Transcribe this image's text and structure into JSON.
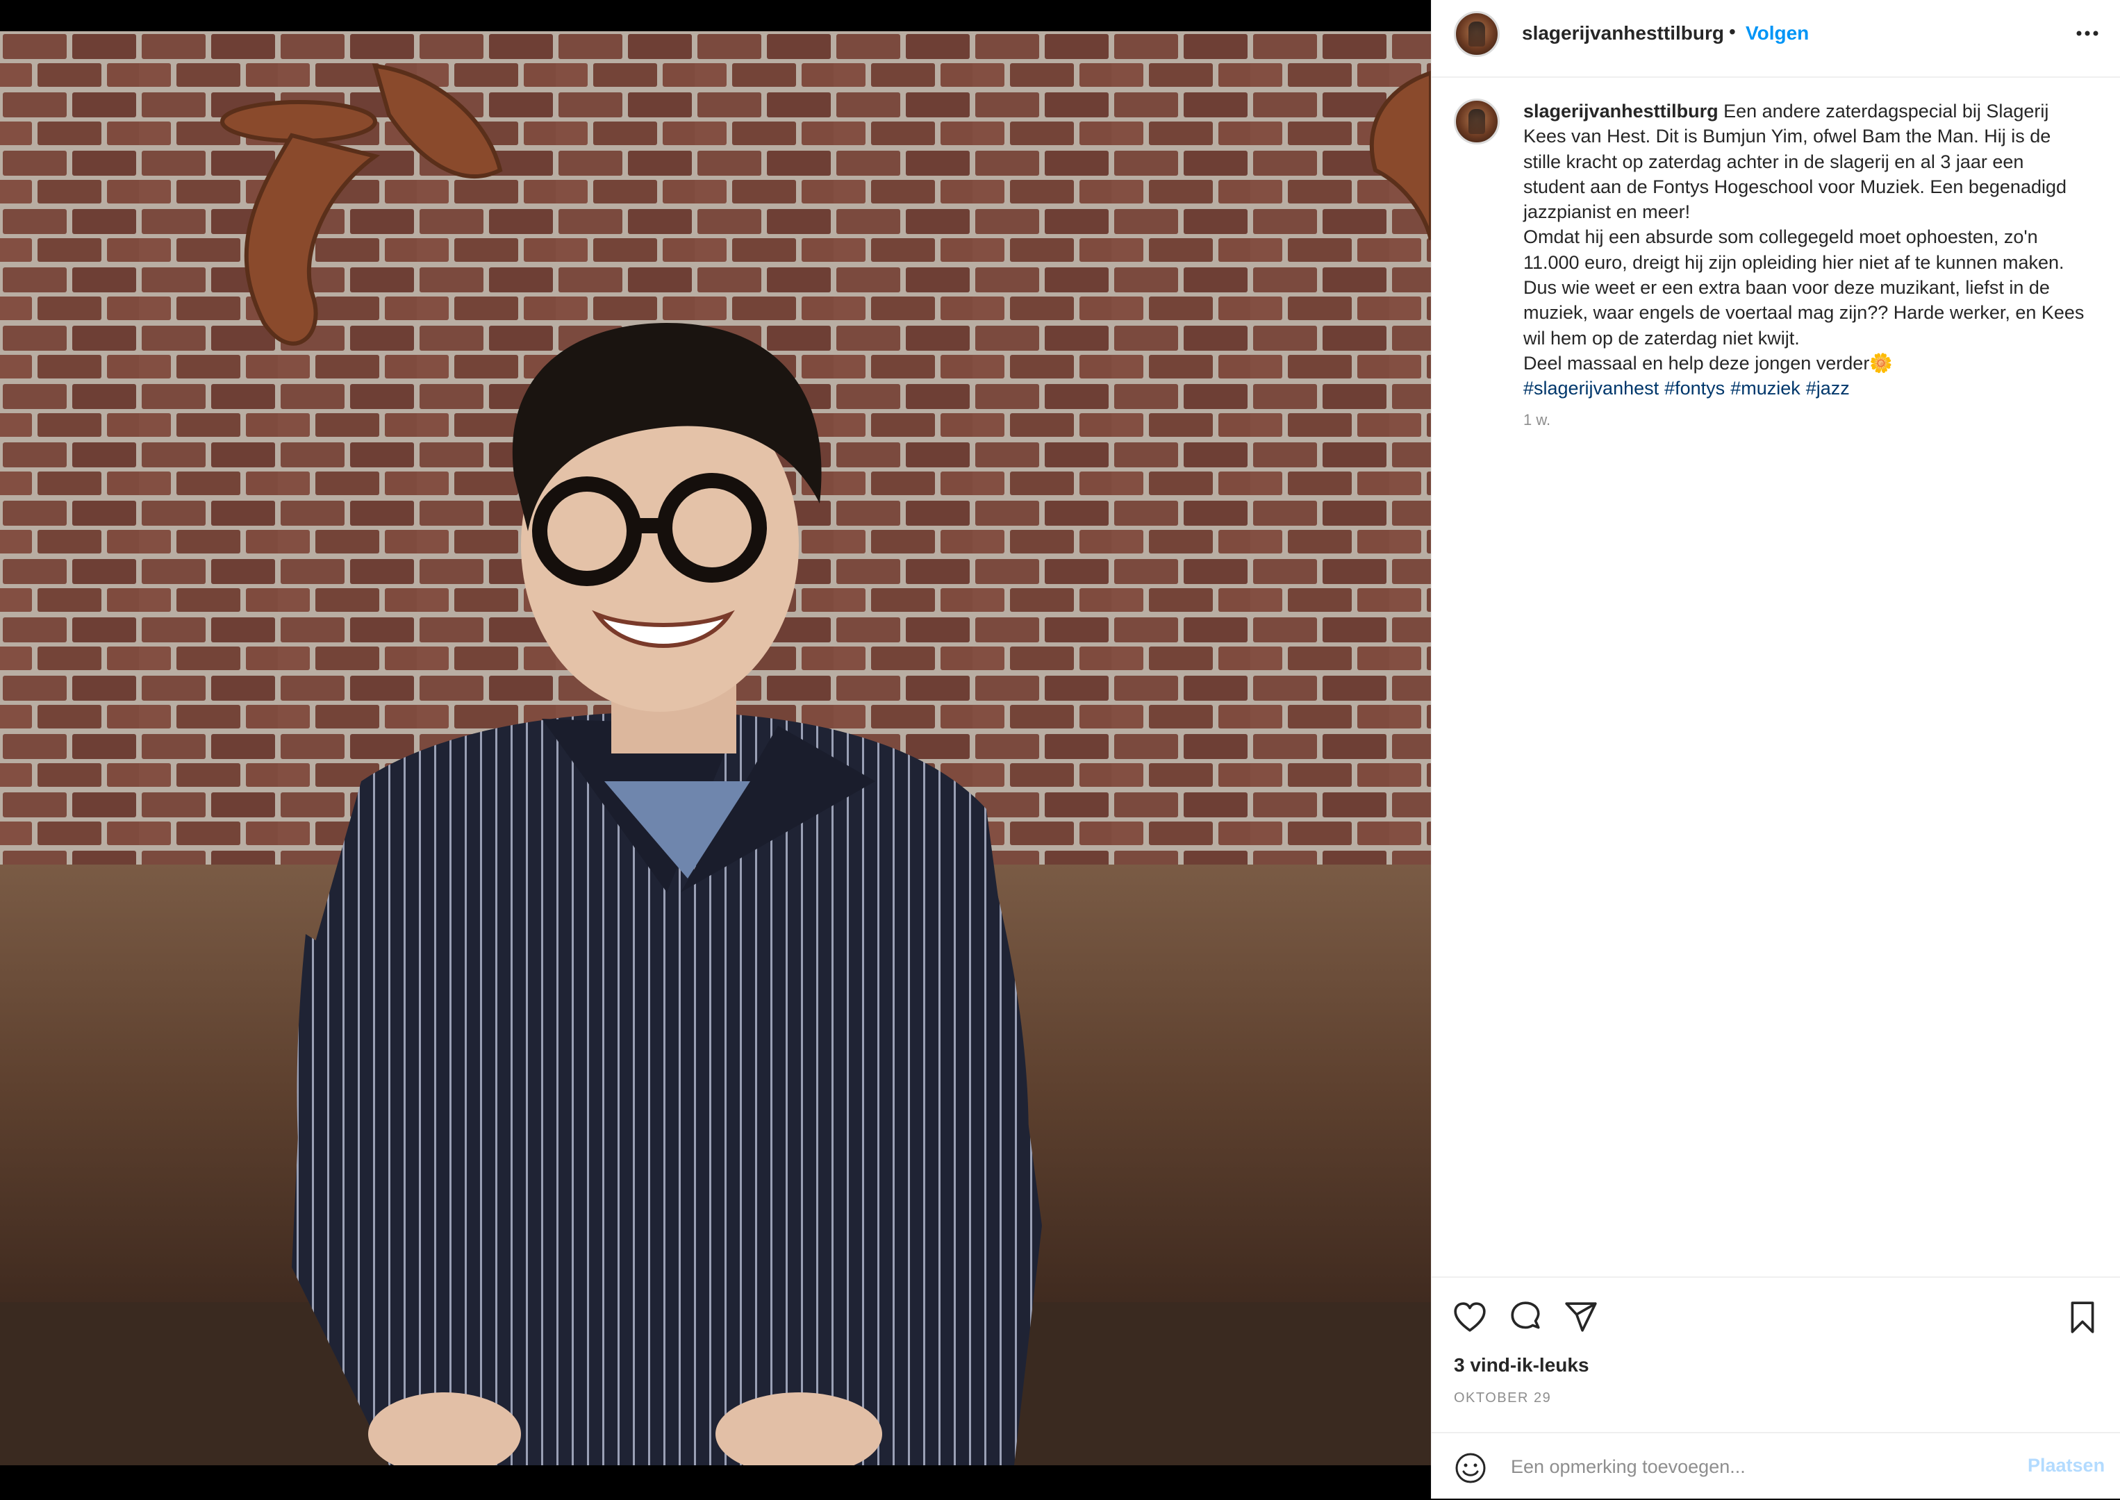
{
  "post": {
    "username": "slagerijvanhesttilburg",
    "follow_label": "Volgen",
    "separator": "•",
    "caption_lines": [
      "Een andere zaterdagspecial bij Slagerij Kees van Hest. Dit is Bumjun Yim, ofwel Bam the Man. Hij is de stille kracht op zaterdag achter in de slagerij en al 3 jaar een student aan de Fontys Hogeschool voor Muziek. Een begenadigd jazzpianist en meer!",
      "Omdat hij een absurde som collegegeld moet ophoesten, zo'n 11.000 euro, dreigt hij zijn opleiding hier niet af te kunnen maken. Dus wie weet er een extra baan voor deze muzikant, liefst in de muziek, waar engels de voertaal mag zijn?? Harde werker, en Kees wil hem op de zaterdag niet kwijt.",
      "Deel massaal en help deze jongen verder🌼"
    ],
    "hashtags": [
      "#slagerijvanhest",
      "#fontys",
      "#muziek",
      "#jazz"
    ],
    "caption_time": "1 w.",
    "likes": "3 vind-ik-leuks",
    "date": "OKTOBER 29",
    "comment_placeholder": "Een opmerking toevoegen...",
    "post_button": "Plaatsen"
  },
  "icons": {
    "more": "more-horizontal-icon",
    "like": "heart-icon",
    "comment": "comment-bubble-icon",
    "share": "paper-plane-icon",
    "save": "bookmark-icon",
    "emoji": "smiley-icon"
  },
  "colors": {
    "link": "#0095f6",
    "hashtag": "#00376b",
    "muted": "#8e8e8e",
    "post_disabled": "#b3dbff"
  }
}
